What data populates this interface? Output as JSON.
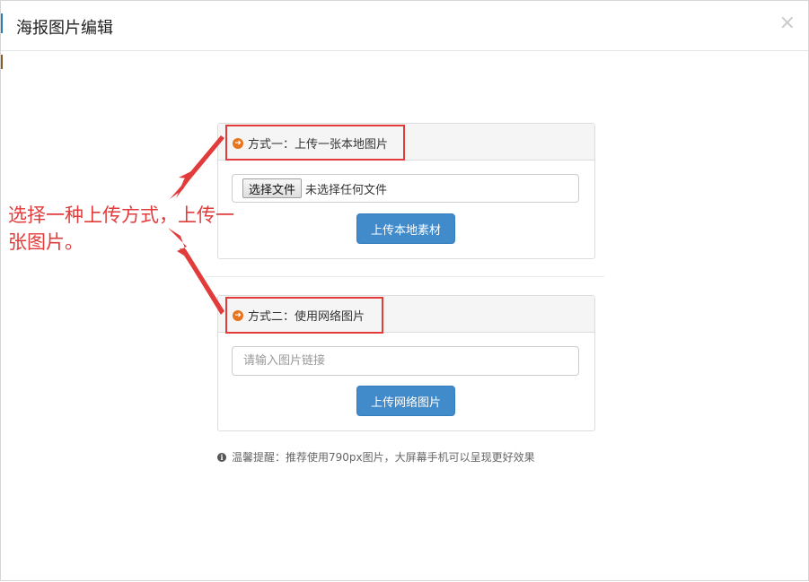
{
  "modal": {
    "title": "海报图片编辑",
    "close_label": "×"
  },
  "method_one": {
    "title": "方式一：上传一张本地图片",
    "choose_file_label": "选择文件",
    "no_file_text": "未选择任何文件",
    "upload_label": "上传本地素材"
  },
  "method_two": {
    "title": "方式二：使用网络图片",
    "url_placeholder": "请输入图片链接",
    "upload_label": "上传网络图片"
  },
  "tip": {
    "icon": "info-icon",
    "text": "温馨提醒：推荐使用790px图片，大屏幕手机可以呈现更好效果"
  },
  "annotation": {
    "text": "选择一种上传方式，上传一张图片。",
    "color": "#e23b3b"
  },
  "colors": {
    "primary": "#428bca",
    "accent_icon": "#e8731d",
    "highlight": "#e23b3b"
  }
}
